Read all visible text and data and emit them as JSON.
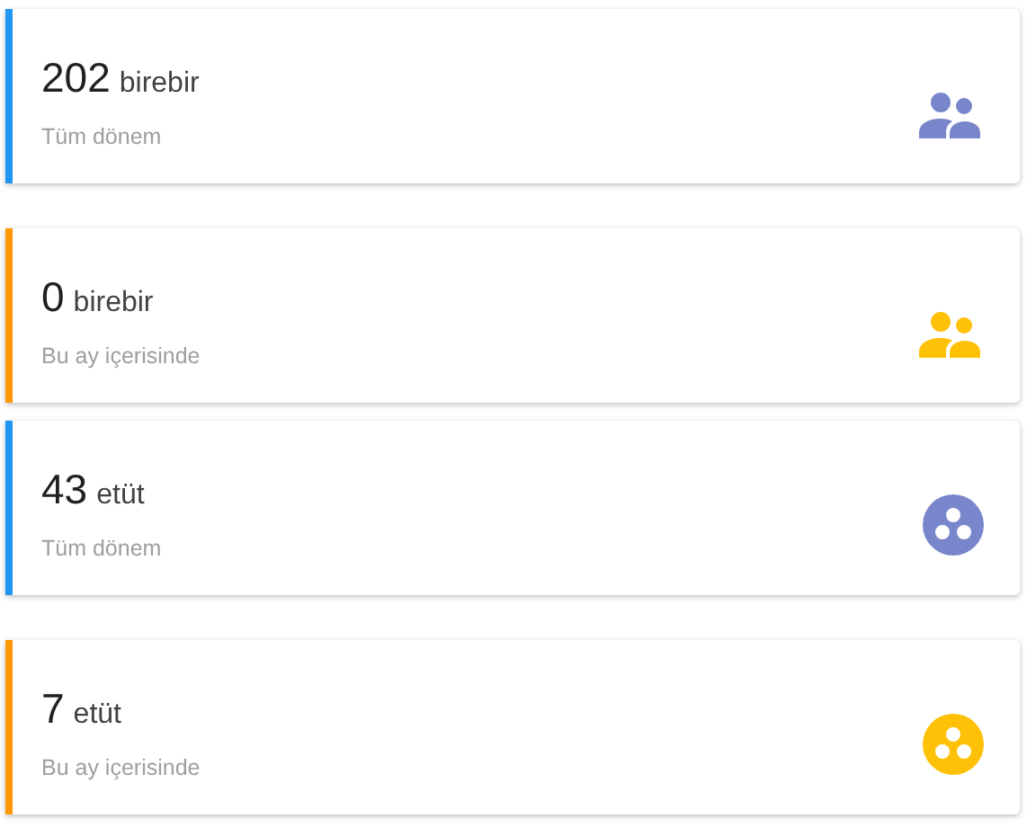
{
  "cards": [
    {
      "value": "202",
      "unit": "birebir",
      "period": "Tüm dönem",
      "color": "#2196f3",
      "kind": "people"
    },
    {
      "value": "0",
      "unit": "birebir",
      "period": "Bu ay içerisinde",
      "color": "#ff9800",
      "kind": "people"
    },
    {
      "value": "43",
      "unit": "etüt",
      "period": "Tüm dönem",
      "color": "#2196f3",
      "kind": "group"
    },
    {
      "value": "7",
      "unit": "etüt",
      "period": "Bu ay içerisinde",
      "color": "#ff9800",
      "kind": "group"
    }
  ]
}
